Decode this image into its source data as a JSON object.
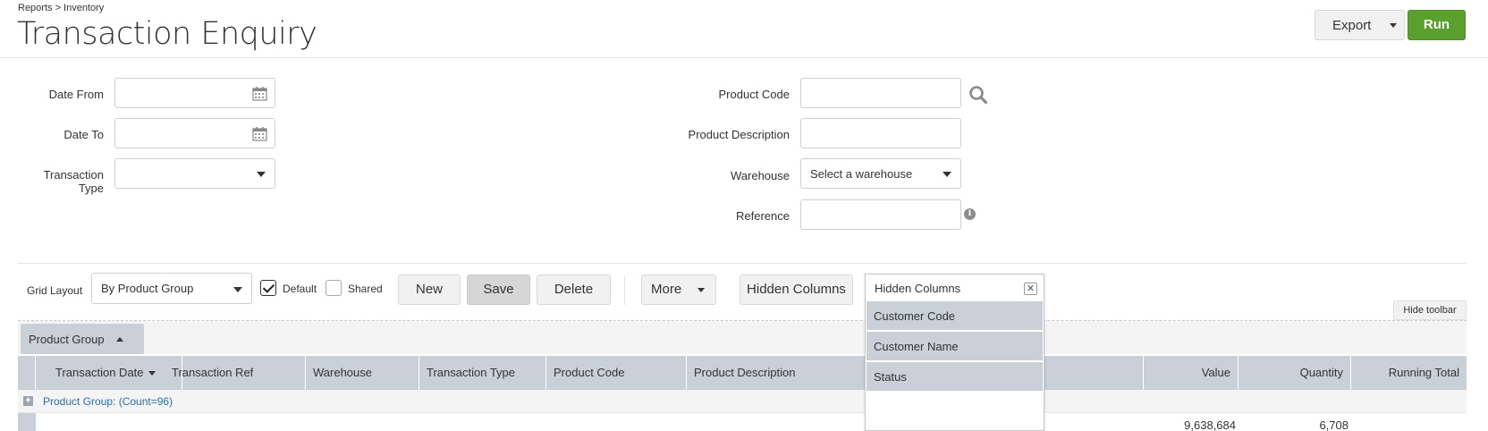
{
  "breadcrumb": "Reports > Inventory",
  "page_title": "Transaction Enquiry",
  "actions": {
    "export_label": "Export",
    "run_label": "Run",
    "run_color": "#5aa02c"
  },
  "form": {
    "date_from_label": "Date From",
    "date_to_label": "Date To",
    "transaction_type_label": "Transaction Type",
    "transaction_type_value": "",
    "product_code_label": "Product Code",
    "product_description_label": "Product Description",
    "warehouse_label": "Warehouse",
    "warehouse_value": "Select a warehouse",
    "reference_label": "Reference",
    "info_glyph": "i"
  },
  "toolbar": {
    "grid_layout_label": "Grid Layout",
    "grid_layout_value": "By Product Group",
    "default_label": "Default",
    "default_checked": true,
    "shared_label": "Shared",
    "shared_checked": false,
    "new_label": "New",
    "save_label": "Save",
    "delete_label": "Delete",
    "more_label": "More",
    "hidden_columns_label": "Hidden Columns",
    "hide_toolbar_label": "Hide toolbar"
  },
  "grouping": {
    "chip_label": "Product Group"
  },
  "grid": {
    "columns": [
      "Transaction Date",
      "Transaction Ref",
      "Warehouse",
      "Transaction Type",
      "Product Code",
      "Product Description",
      "Value",
      "Quantity",
      "Running Total"
    ],
    "group_row_label": "Product Group: (Count=96)",
    "expand_glyph": "+",
    "totals": {
      "value": "9,638,684",
      "quantity": "6,708"
    }
  },
  "hidden_columns_panel": {
    "title": "Hidden Columns",
    "close_glyph": "✕",
    "items": [
      "Customer Code",
      "Customer Name",
      "Status"
    ]
  }
}
